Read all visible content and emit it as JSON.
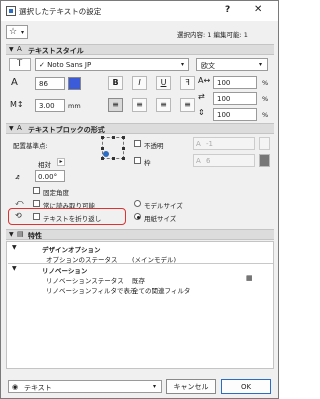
{
  "window": {
    "title": "選択したテキストの設定",
    "help": "?",
    "close": "✕"
  },
  "top": {
    "favorites_star": "☆",
    "favorites_caret": "▾",
    "selection_info": "選択内容: 1 編集可能: 1"
  },
  "text_style": {
    "header": "テキストスタイル",
    "font_value": "✓ Noto Sans JP",
    "script_value": "欧文",
    "size_value": "86",
    "pen_color": "#3b5bdb",
    "bold": "B",
    "italic": "I",
    "underline": "U",
    "strikeout": "ꟻ",
    "width_value": "100",
    "spacing_value": "100",
    "line_value": "100",
    "percent": "%",
    "height_value": "3.00",
    "height_unit": "mm"
  },
  "text_block": {
    "header": "テキストブロックの形式",
    "anchor_label": "配置基準点:",
    "opaque_label": "不透明",
    "opaque_value": "-1",
    "frame_label": "枠",
    "frame_value": "6",
    "relative_label": "相対",
    "angle_value": "0.00°",
    "fixed_angle_label": "固定角度",
    "always_readable_label": "常に読み取り可能",
    "wrap_text_label": "テキストを折り返し",
    "model_size_label": "モデルサイズ",
    "paper_size_label": "用紙サイズ",
    "highlight_color": "#e03131"
  },
  "properties": {
    "header": "特性",
    "groups": [
      {
        "name": "デザインオプション",
        "rows": [
          {
            "key": "オプションのステータス",
            "value": "(メインモデル)"
          }
        ]
      },
      {
        "name": "リノベーション",
        "rows": [
          {
            "key": "リノベーションステータス",
            "value": "既存"
          },
          {
            "key": "リノベーションフィルタで表示",
            "value": "全ての関連フィルタ"
          }
        ]
      }
    ]
  },
  "footer": {
    "layer_value": "テキスト",
    "cancel_label": "キャンセル",
    "ok_label": "OK"
  }
}
